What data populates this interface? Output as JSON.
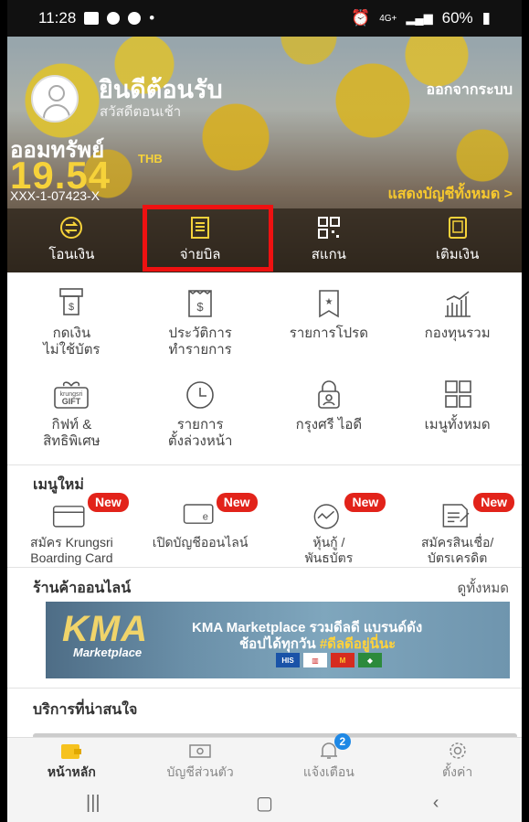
{
  "statusbar": {
    "time": "11:28",
    "network": "4G+",
    "battery": "60%"
  },
  "header": {
    "welcome": "ยินดีต้อนรับ",
    "greeting": "สวัสดีตอนเช้า",
    "logout": "ออกจากระบบ"
  },
  "account": {
    "type": "ออมทรัพย์",
    "balance": "19.54",
    "currency": "THB",
    "number": "XXX-1-07423-X",
    "show_all": "แสดงบัญชีทั้งหมด >"
  },
  "quick_actions": [
    {
      "label": "โอนเงิน",
      "icon": "transfer-icon"
    },
    {
      "label": "จ่ายบิล",
      "icon": "bill-icon"
    },
    {
      "label": "สแกน",
      "icon": "qr-scan-icon"
    },
    {
      "label": "เติมเงิน",
      "icon": "topup-icon"
    }
  ],
  "menu": [
    {
      "line1": "กดเงิน",
      "line2": "ไม่ใช้บัตร",
      "icon": "atm-cardless-icon"
    },
    {
      "line1": "ประวัติการ",
      "line2": "ทำรายการ",
      "icon": "receipt-icon"
    },
    {
      "line1": "รายการโปรด",
      "line2": "",
      "icon": "favorite-icon"
    },
    {
      "line1": "กองทุนรวม",
      "line2": "",
      "icon": "fund-icon"
    },
    {
      "line1": "กิฟท์ &",
      "line2": "สิทธิพิเศษ",
      "icon": "gift-icon"
    },
    {
      "line1": "รายการ",
      "line2": "ตั้งล่วงหน้า",
      "icon": "clock-icon"
    },
    {
      "line1": "กรุงศรี ไอดี",
      "line2": "",
      "icon": "id-lock-icon"
    },
    {
      "line1": "เมนูทั้งหมด",
      "line2": "",
      "icon": "all-menu-icon"
    }
  ],
  "gift_icon_text": {
    "top": "krungsri",
    "bottom": "GIFT"
  },
  "new_menu": {
    "title": "เมนูใหม่",
    "badge": "New",
    "items": [
      {
        "line1": "สมัคร Krungsri",
        "line2": "Boarding Card",
        "icon": "card-icon"
      },
      {
        "line1": "เปิดบัญชีออนไลน์",
        "line2": "",
        "icon": "e-account-icon"
      },
      {
        "line1": "หุ้นกู้ /",
        "line2": "พันธบัตร",
        "icon": "bond-chart-icon"
      },
      {
        "line1": "สมัครสินเชื่อ/",
        "line2": "บัตรเครดิต",
        "icon": "loan-form-icon"
      }
    ]
  },
  "online_shop": {
    "title": "ร้านค้าออนไลน์",
    "see_all": "ดูทั้งหมด",
    "banner": {
      "logo": "KMA",
      "logo_sub": "Marketplace",
      "line1": "KMA Marketplace รวมดีลดี แบรนด์ดัง",
      "line2_prefix": "ช้อปได้ทุกวัน ",
      "line2_highlight": "#ดีลดีอยู่นี่นะ",
      "brands": [
        "HIS",
        "",
        "M",
        ""
      ]
    }
  },
  "services": {
    "title": "บริการที่น่าสนใจ"
  },
  "tabbar": [
    {
      "label": "หน้าหลัก",
      "icon": "home-wallet-icon",
      "active": true
    },
    {
      "label": "บัญชีส่วนตัว",
      "icon": "money-icon",
      "active": false
    },
    {
      "label": "แจ้งเตือน",
      "icon": "bell-icon",
      "active": false,
      "badge": "2"
    },
    {
      "label": "ตั้งค่า",
      "icon": "gear-icon",
      "active": false
    }
  ],
  "colors": {
    "accent": "#f6d23a",
    "highlight": "#ee1111",
    "new_badge": "#e2231a"
  }
}
